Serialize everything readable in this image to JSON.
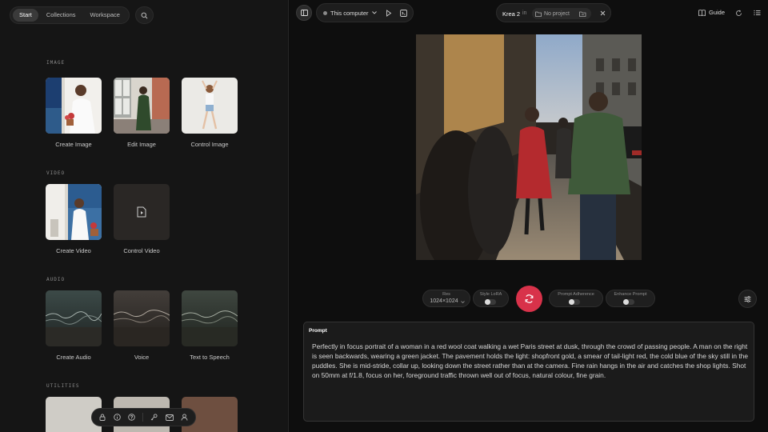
{
  "nav": {
    "tabs": [
      {
        "label": "Start",
        "active": true
      },
      {
        "label": "Collections",
        "active": false
      },
      {
        "label": "Workspace",
        "active": false
      }
    ],
    "search_icon": "search-icon"
  },
  "sections": {
    "image": {
      "label": "IMAGE",
      "cards": [
        {
          "label": "Create Image"
        },
        {
          "label": "Edit Image"
        },
        {
          "label": "Control Image"
        }
      ]
    },
    "video": {
      "label": "VIDEO",
      "cards": [
        {
          "label": "Create Video"
        },
        {
          "label": "Control Video"
        }
      ]
    },
    "audio": {
      "label": "AUDIO",
      "cards": [
        {
          "label": "Create Audio"
        },
        {
          "label": "Voice"
        },
        {
          "label": "Text to Speech"
        }
      ]
    },
    "utilities": {
      "label": "UTILITIES"
    }
  },
  "bottom_bar": {
    "icons": [
      "lock-icon",
      "info-icon",
      "help-icon",
      "key-icon",
      "mail-icon",
      "user-icon"
    ]
  },
  "topbar": {
    "location": "This computer",
    "model": "Krea 2",
    "in_label": "in",
    "project": "No project",
    "guide_label": "Guide"
  },
  "controls": {
    "res": {
      "label": "Res",
      "value": "1024×1024"
    },
    "style_lora": {
      "label": "Style LoRA",
      "enabled": false
    },
    "prompt_adherence": {
      "label": "Prompt Adherence",
      "enabled": false
    },
    "enhance_prompt": {
      "label": "Enhance Prompt",
      "enabled": false
    }
  },
  "prompt": {
    "title": "Prompt",
    "text": "Perfectly in focus portrait of a woman in a red wool coat walking a wet Paris street at dusk, through the crowd of passing people. A man on the right is seen backwards, wearing a green jacket. The pavement holds the light: shopfront gold, a smear of tail-light red, the cold blue of the sky still in the puddles. She is mid-stride, collar up, looking down the street rather than at the camera. Fine rain hangs in the air and catches the shop lights. Shot on 50mm at f/1.8, focus on her, foreground traffic thrown well out of focus, natural colour, fine grain."
  },
  "colors": {
    "accent": "#d8324a",
    "status_dot": "#8a8a8a"
  }
}
